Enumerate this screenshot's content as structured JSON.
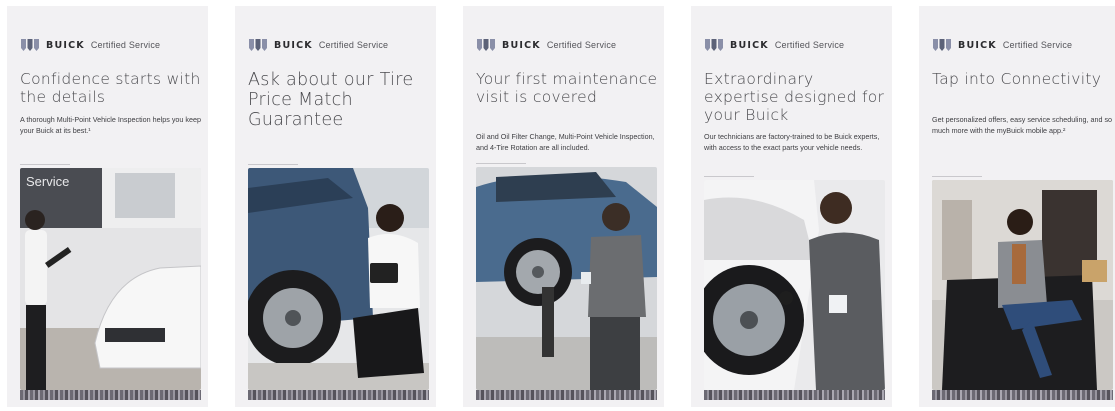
{
  "brand": {
    "name": "BUICK",
    "suffix": "Certified Service"
  },
  "cards": [
    {
      "headline": "Confidence starts with the details",
      "body": "A thorough Multi-Point Vehicle Inspection helps you keep your Buick at its best.¹",
      "photo_text": "Service"
    },
    {
      "headline": "Ask about our Tire Price Match Guarantee",
      "body": ""
    },
    {
      "headline": "Your first maintenance visit is covered",
      "body": "Oil and Oil Filter Change, Multi-Point Vehicle Inspection, and 4-Tire Rotation are all included."
    },
    {
      "headline": "Extraordinary expertise designed for your Buick",
      "body": "Our technicians are factory-trained to be Buick experts, with access to the exact parts your vehicle needs."
    },
    {
      "headline": "Tap into Connectivity",
      "body": "Get personalized offers, easy service scheduling, and so much more with the myBuick mobile app.²"
    }
  ],
  "colors": {
    "card_bg": "#f2f1f3",
    "text": "#4a4a4e"
  }
}
